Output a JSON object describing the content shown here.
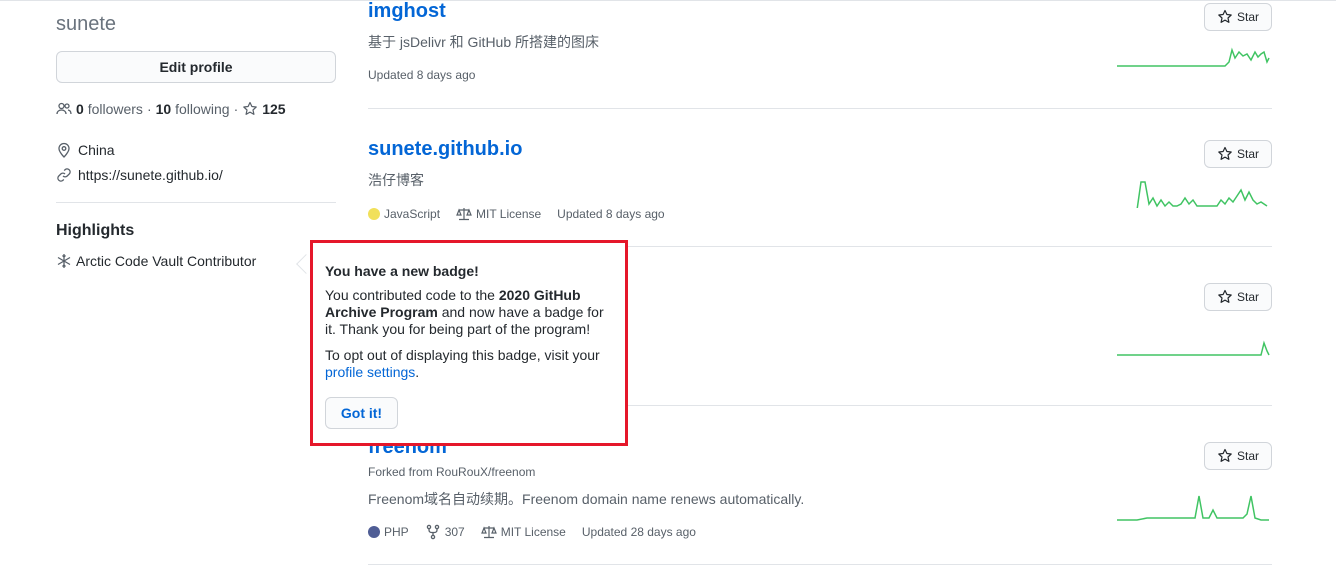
{
  "profile": {
    "username": "sunete",
    "edit_label": "Edit profile",
    "followers_count": "0",
    "followers_label": "followers",
    "following_count": "10",
    "following_label": "following",
    "stars_count": "125",
    "location": "China",
    "website": "https://sunete.github.io/",
    "highlights_title": "Highlights",
    "highlight_item": "Arctic Code Vault Contributor"
  },
  "repos": [
    {
      "name": "imghost",
      "description": "基于 jsDelivr 和 GitHub 所搭建的图床",
      "updated": "Updated 8 days ago",
      "star_label": "Star"
    },
    {
      "name": "sunete.github.io",
      "description": "浩仔博客",
      "language": "JavaScript",
      "language_color": "#f1e05a",
      "license": "MIT License",
      "updated": "Updated 8 days ago",
      "star_label": "Star"
    },
    {
      "star_label": "Star"
    },
    {
      "name": "freenom",
      "forked_from": "Forked from RouRouX/freenom",
      "description": "Freenom域名自动续期。Freenom domain name renews automatically.",
      "language": "PHP",
      "language_color": "#4F5D95",
      "forks": "307",
      "license": "MIT License",
      "updated": "Updated 28 days ago",
      "star_label": "Star"
    }
  ],
  "popover": {
    "title": "You have a new badge!",
    "text1_a": "You contributed code to the ",
    "text1_b": "2020 GitHub Archive Program",
    "text1_c": " and now have a badge for it. Thank you for being part of the program!",
    "text2_a": "To opt out of displaying this badge, visit your ",
    "text2_link": "profile settings",
    "text2_c": ".",
    "button_label": "Got it!",
    "border_color": "#e5172a"
  },
  "colors": {
    "link": "#0366d6",
    "spark": "#40c463"
  }
}
